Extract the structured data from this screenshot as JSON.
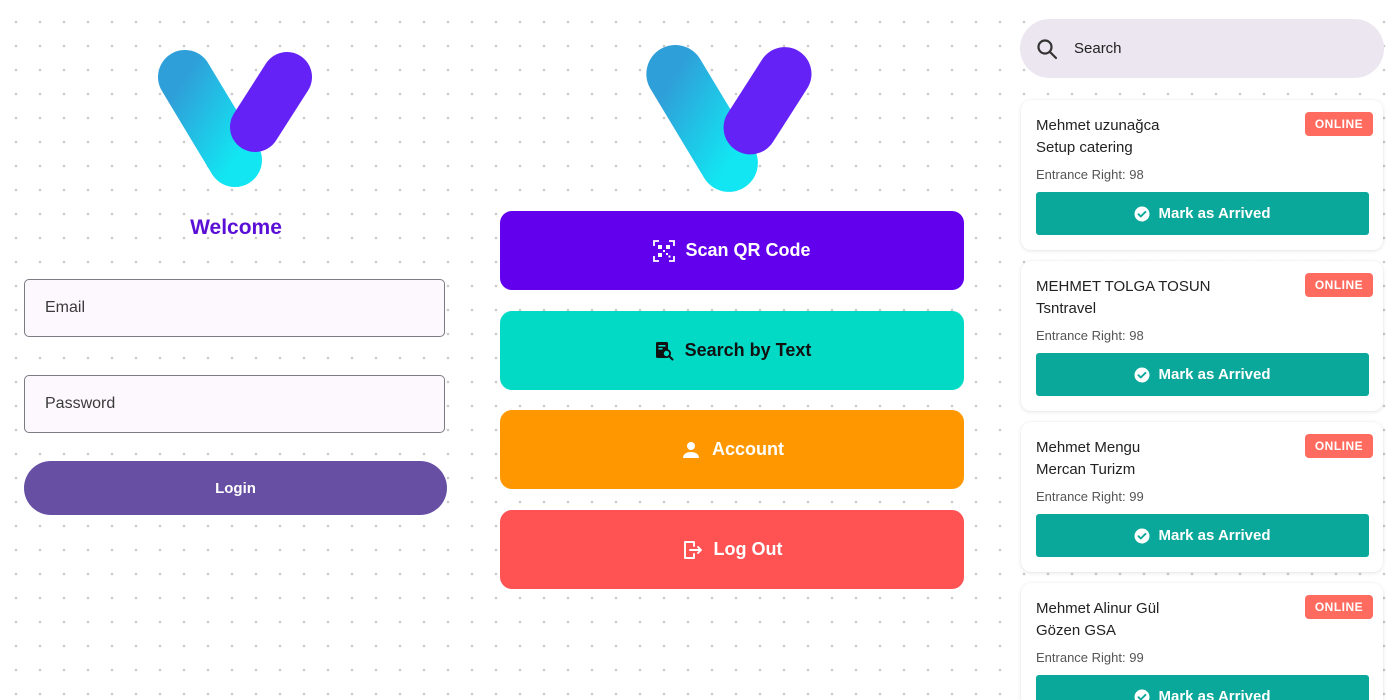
{
  "login": {
    "welcome": "Welcome",
    "email_placeholder": "Email",
    "password_placeholder": "Password",
    "login_label": "Login"
  },
  "menu": {
    "scan_qr_label": "Scan QR Code",
    "search_text_label": "Search by Text",
    "account_label": "Account",
    "logout_label": "Log Out"
  },
  "search": {
    "placeholder": "Search"
  },
  "cards": [
    {
      "name": "Mehmet uzunağca",
      "company": "Setup catering",
      "entrance": "Entrance Right: 98",
      "status": "ONLINE",
      "action": "Mark as Arrived"
    },
    {
      "name": "MEHMET TOLGA TOSUN",
      "company": "Tsntravel",
      "entrance": "Entrance Right: 98",
      "status": "ONLINE",
      "action": "Mark as Arrived"
    },
    {
      "name": "Mehmet Mengu",
      "company": "Mercan Turizm",
      "entrance": "Entrance Right: 99",
      "status": "ONLINE",
      "action": "Mark as Arrived"
    },
    {
      "name": "Mehmet Alinur Gül",
      "company": "Gözen GSA",
      "entrance": "Entrance Right: 99",
      "status": "ONLINE",
      "action": "Mark as Arrived"
    }
  ],
  "colors": {
    "primary": "#6200ee",
    "welcome": "#5a0fd6",
    "login_button": "#6750a4",
    "teal": "#03dac6",
    "orange": "#ff9800",
    "red": "#ff5252",
    "badge": "#ff6b5e",
    "arrive_button": "#0aa89a",
    "search_bg": "#ece6f0"
  },
  "icons": [
    "logo-v-icon",
    "qr-code-icon",
    "search-document-icon",
    "person-icon",
    "logout-icon",
    "search-icon",
    "check-circle-icon"
  ]
}
